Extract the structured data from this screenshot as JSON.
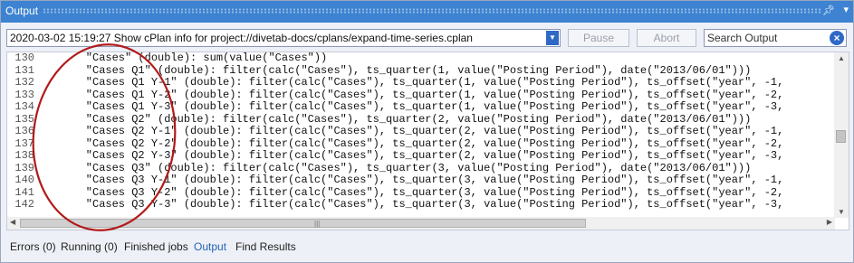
{
  "window": {
    "title": "Output"
  },
  "toolbar": {
    "selector_value": "2020-03-02 15:19:27 Show cPlan info for project://divetab-docs/cplans/expand-time-series.cplan",
    "pause_label": "Pause",
    "abort_label": "Abort",
    "search_placeholder": "Search Output"
  },
  "output_lines": [
    {
      "num": "130",
      "text": "    \"Cases\" (double): sum(value(\"Cases\"))"
    },
    {
      "num": "131",
      "text": "    \"Cases Q1\" (double): filter(calc(\"Cases\"), ts_quarter(1, value(\"Posting Period\"), date(\"2013/06/01\")))"
    },
    {
      "num": "132",
      "text": "    \"Cases Q1 Y-1\" (double): filter(calc(\"Cases\"), ts_quarter(1, value(\"Posting Period\"), ts_offset(\"year\", -1,"
    },
    {
      "num": "133",
      "text": "    \"Cases Q1 Y-2\" (double): filter(calc(\"Cases\"), ts_quarter(1, value(\"Posting Period\"), ts_offset(\"year\", -2,"
    },
    {
      "num": "134",
      "text": "    \"Cases Q1 Y-3\" (double): filter(calc(\"Cases\"), ts_quarter(1, value(\"Posting Period\"), ts_offset(\"year\", -3,"
    },
    {
      "num": "135",
      "text": "    \"Cases Q2\" (double): filter(calc(\"Cases\"), ts_quarter(2, value(\"Posting Period\"), date(\"2013/06/01\")))"
    },
    {
      "num": "136",
      "text": "    \"Cases Q2 Y-1\" (double): filter(calc(\"Cases\"), ts_quarter(2, value(\"Posting Period\"), ts_offset(\"year\", -1,"
    },
    {
      "num": "137",
      "text": "    \"Cases Q2 Y-2\" (double): filter(calc(\"Cases\"), ts_quarter(2, value(\"Posting Period\"), ts_offset(\"year\", -2,"
    },
    {
      "num": "138",
      "text": "    \"Cases Q2 Y-3\" (double): filter(calc(\"Cases\"), ts_quarter(2, value(\"Posting Period\"), ts_offset(\"year\", -3,"
    },
    {
      "num": "139",
      "text": "    \"Cases Q3\" (double): filter(calc(\"Cases\"), ts_quarter(3, value(\"Posting Period\"), date(\"2013/06/01\")))"
    },
    {
      "num": "140",
      "text": "    \"Cases Q3 Y-1\" (double): filter(calc(\"Cases\"), ts_quarter(3, value(\"Posting Period\"), ts_offset(\"year\", -1,"
    },
    {
      "num": "141",
      "text": "    \"Cases Q3 Y-2\" (double): filter(calc(\"Cases\"), ts_quarter(3, value(\"Posting Period\"), ts_offset(\"year\", -2,"
    },
    {
      "num": "142",
      "text": "    \"Cases Q3 Y-3\" (double): filter(calc(\"Cases\"), ts_quarter(3, value(\"Posting Period\"), ts_offset(\"year\", -3,"
    }
  ],
  "tabs": [
    {
      "label": "Errors (0)",
      "active": false
    },
    {
      "label": "Running (0)",
      "active": false
    },
    {
      "label": "Finished jobs",
      "active": false
    },
    {
      "label": "Output",
      "active": true
    },
    {
      "label": "Find Results",
      "active": false
    }
  ],
  "colors": {
    "titlebar": "#3d83d1",
    "annotation": "#b11a1a",
    "active_tab": "#2563b6"
  },
  "icons": {
    "pin": "pin-icon",
    "dropdown": "dropdown-icon",
    "clear": "clear-search-icon"
  }
}
